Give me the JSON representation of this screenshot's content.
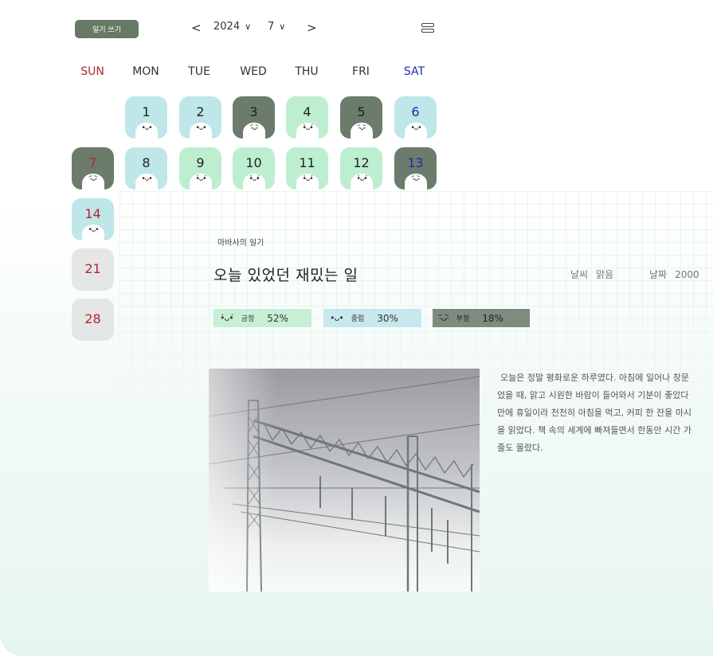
{
  "header": {
    "write_button": "일기 쓰기",
    "prev": "<",
    "year": "2024",
    "month": "7",
    "next": ">",
    "chevron": "∨",
    "menu_icon": "layout-icon"
  },
  "weekdays": [
    "SUN",
    "MON",
    "TUE",
    "WED",
    "THU",
    "FRI",
    "SAT"
  ],
  "days": [
    {
      "n": "1",
      "mood": "neutral",
      "color": "blue"
    },
    {
      "n": "2",
      "mood": "neutral",
      "color": "blue"
    },
    {
      "n": "3",
      "mood": "negative",
      "color": "dark"
    },
    {
      "n": "4",
      "mood": "positive",
      "color": "green"
    },
    {
      "n": "5",
      "mood": "negative",
      "color": "dark"
    },
    {
      "n": "6",
      "mood": "neutral",
      "color": "blue"
    },
    {
      "n": "7",
      "mood": "negative",
      "color": "dark"
    },
    {
      "n": "8",
      "mood": "neutral",
      "color": "blue"
    },
    {
      "n": "9",
      "mood": "positive",
      "color": "green"
    },
    {
      "n": "10",
      "mood": "positive",
      "color": "green"
    },
    {
      "n": "11",
      "mood": "positive",
      "color": "green"
    },
    {
      "n": "12",
      "mood": "positive",
      "color": "green"
    },
    {
      "n": "13",
      "mood": "negative",
      "color": "dark"
    },
    {
      "n": "14",
      "mood": "neutral",
      "color": "blue"
    },
    {
      "n": "21",
      "mood": "none",
      "color": "gray"
    },
    {
      "n": "28",
      "mood": "none",
      "color": "gray"
    }
  ],
  "diary": {
    "owner": "마바사의 일기",
    "title": "오늘 있었던 재밌는 일",
    "weather_label": "날씨",
    "weather_value": "맑음",
    "date_label": "날짜",
    "date_value": "2000",
    "stats": {
      "positive": {
        "face": "•̀ᴗ•́",
        "label": "긍정",
        "percent": "52%"
      },
      "neutral": {
        "face": "•ᴗ•",
        "label": "중립",
        "percent": "30%"
      },
      "negative": {
        "face": "-᷄ᴗ-᷅",
        "label": "부정",
        "percent": "18%"
      }
    },
    "text_lines": [
      "오늘은 정말 평화로운 하루였다. 아침에 일어나 창문",
      "었을 때, 맑고 시원한 바람이 들어와서 기분이 좋았다",
      "만에 휴일이라 천천히 아침을 먹고, 커피 한 잔을 마시",
      "을 읽었다. 책 속의 세계에 빠져들면서 한동안 시간 가",
      "줄도 몰랐다."
    ]
  },
  "colors": {
    "accent": "#667a66",
    "positive": "#bdeed0",
    "neutral": "#bfe6e9",
    "negative": "#6b7b6c",
    "sunday": "#b3262d",
    "saturday": "#1c2bb0"
  }
}
